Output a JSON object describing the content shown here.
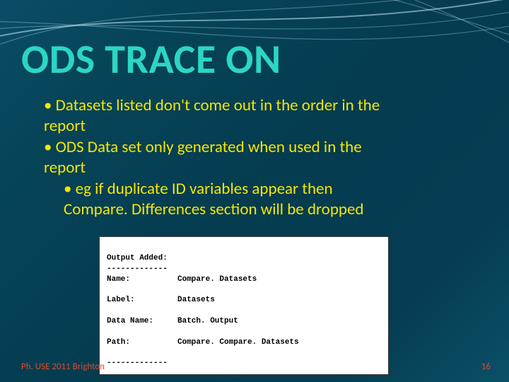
{
  "title": "ODS TRACE ON",
  "bullets": {
    "b1_l1": "• Datasets listed don't come out in the order in the",
    "b1_l2": "report",
    "b2_l1": "• ODS Data set only generated when used in the",
    "b2_l2": "report",
    "b3_l1": "• eg if duplicate ID variables appear then",
    "b3_l2": "Compare. Differences section will be dropped"
  },
  "code": {
    "line1": "Output Added:",
    "sep": "-------------",
    "name_k": "Name:",
    "name_v": "Compare. Datasets",
    "label_k": "Label:",
    "label_v": "Datasets",
    "data_k": "Data Name:",
    "data_v": "Batch. Output",
    "path_k": "Path:",
    "path_v": "Compare. Compare. Datasets"
  },
  "footer": {
    "left": "Ph. USE 2011 Brighton",
    "right": "16"
  }
}
